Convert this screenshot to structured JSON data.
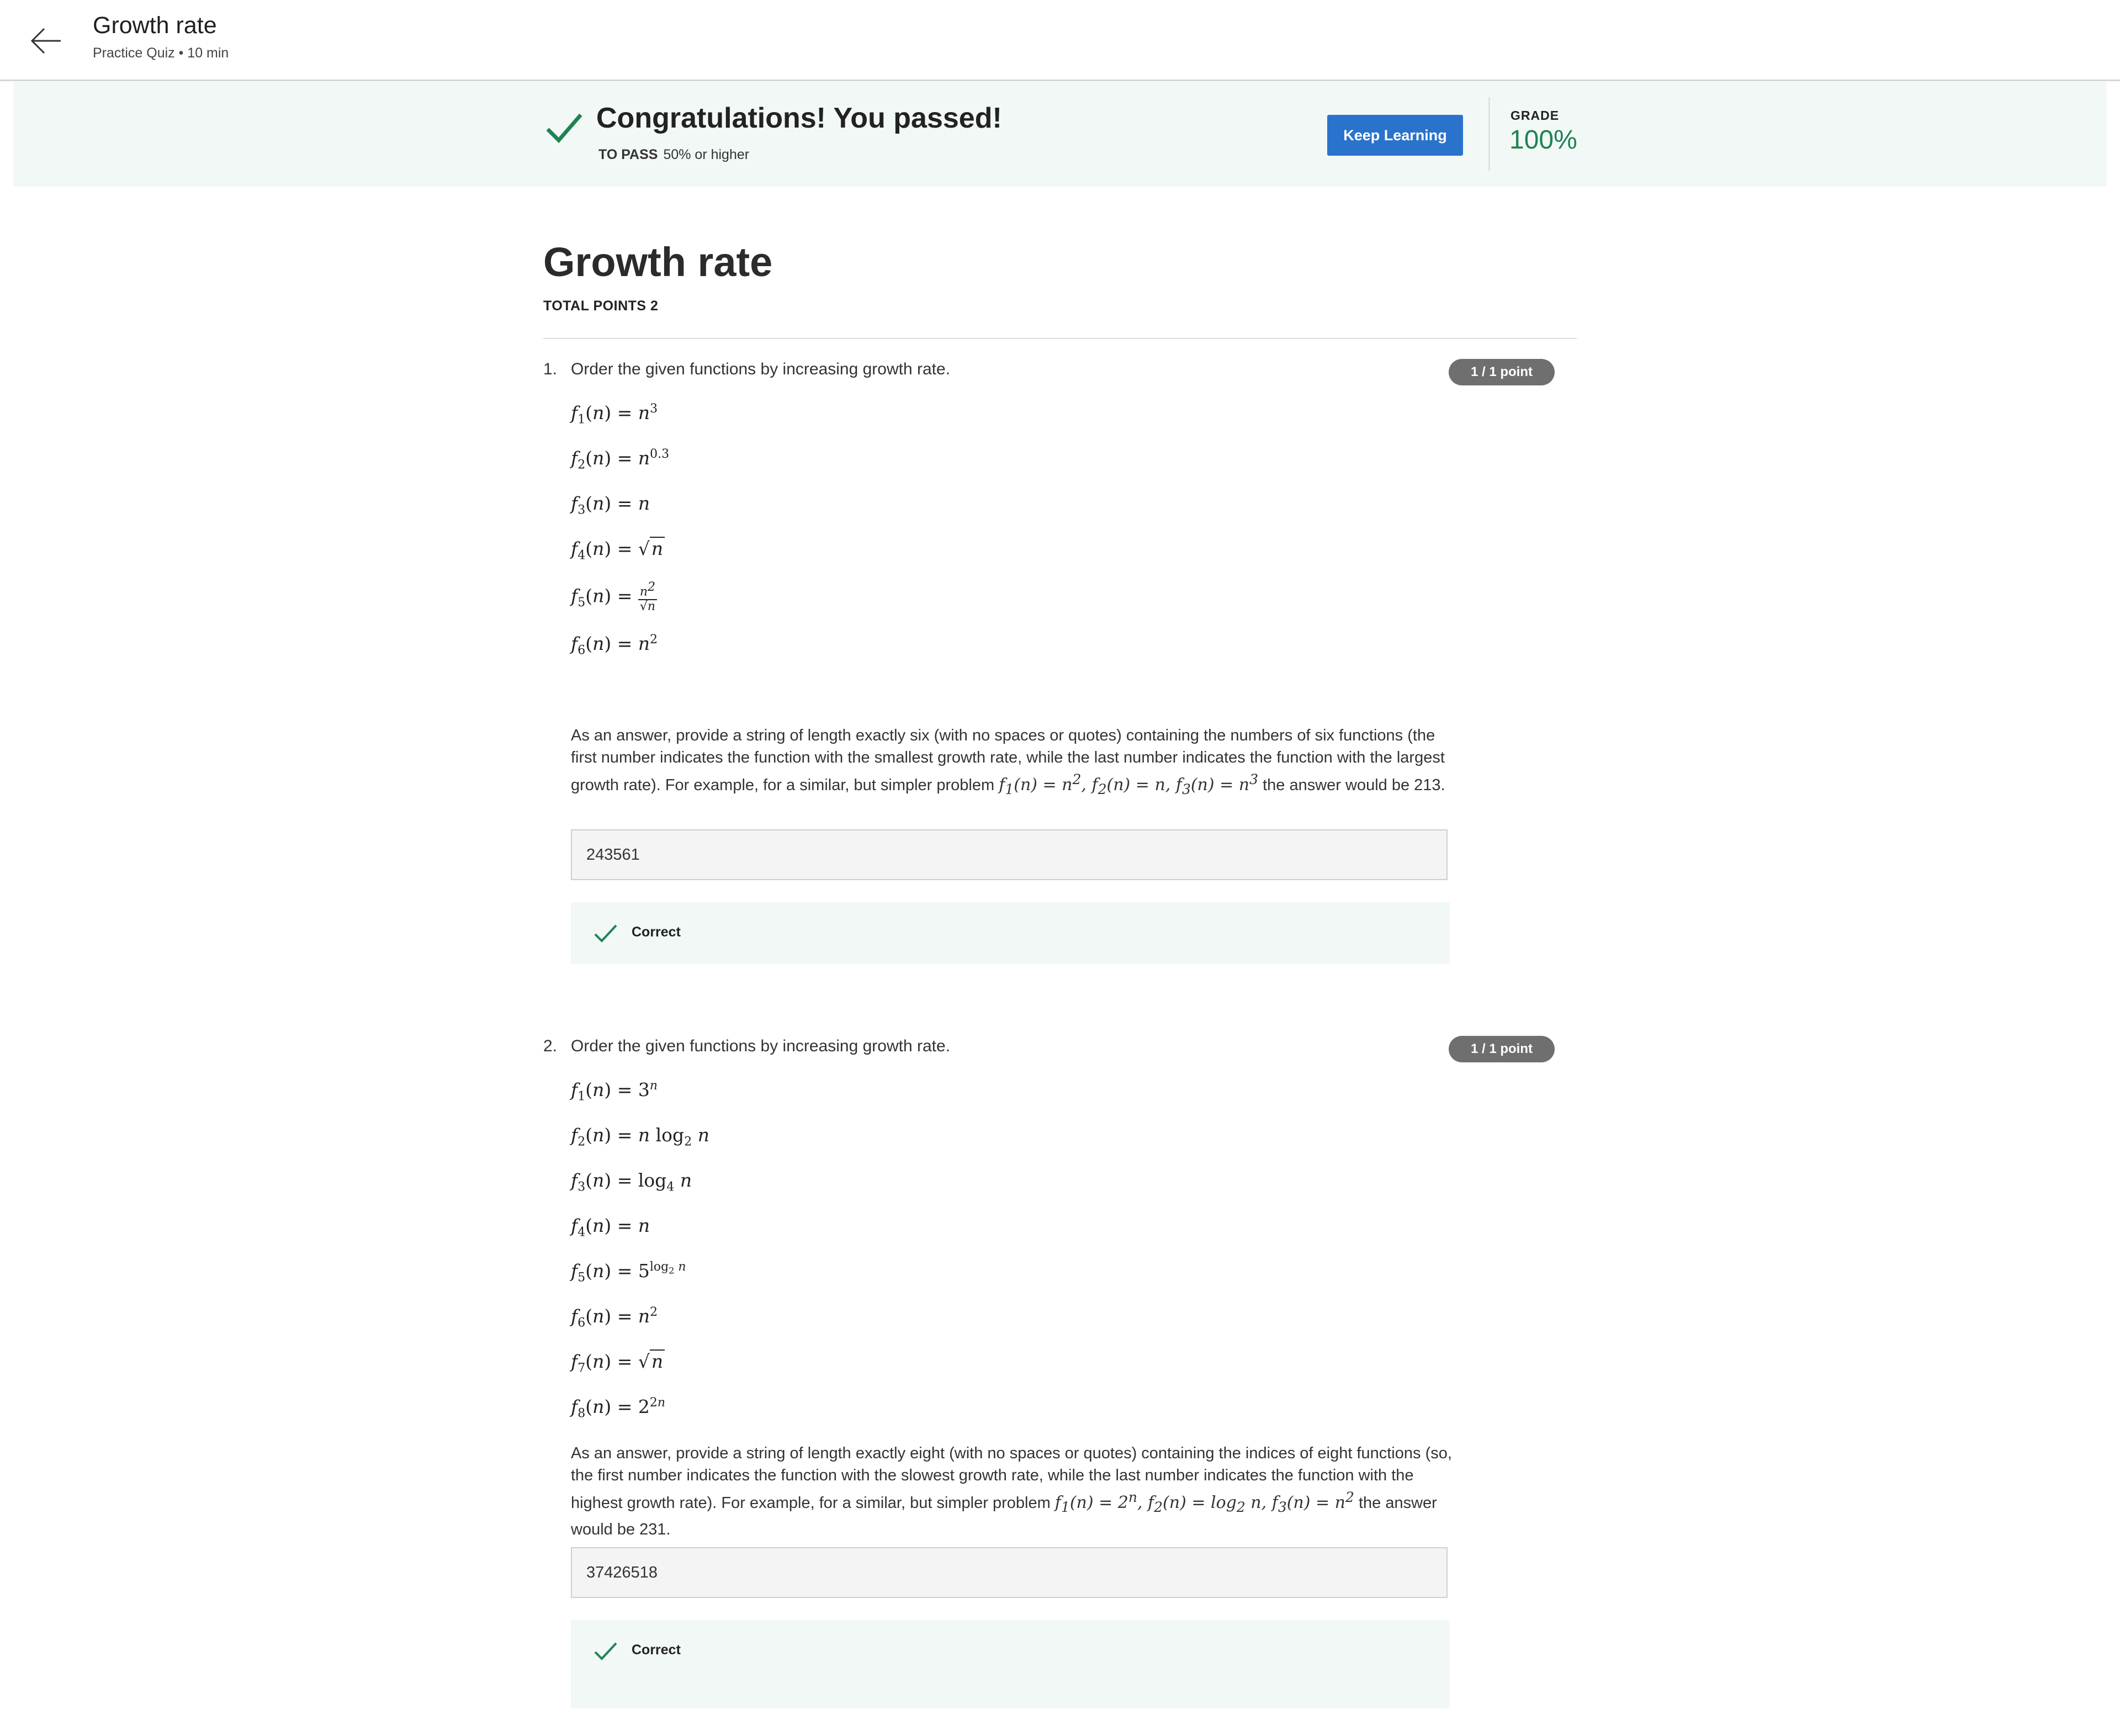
{
  "header": {
    "back_icon": "arrow-left-icon",
    "title": "Growth rate",
    "subtitle": "Practice Quiz • 10 min"
  },
  "banner": {
    "check_icon": "checkmark-icon",
    "title": "Congratulations! You passed!",
    "to_pass_label": "TO PASS",
    "to_pass_value": "50% or higher",
    "keep_learning": "Keep Learning",
    "grade_label": "GRADE",
    "grade_value": "100%",
    "accent_color": "#1f8354",
    "button_color": "#2a73cc"
  },
  "quiz": {
    "title": "Growth rate",
    "total_points": "TOTAL POINTS 2",
    "questions": [
      {
        "number": "1.",
        "prompt": "Order the given functions by increasing growth rate.",
        "points": "1 / 1 point",
        "formulas": [
          "f1(n) = n^3",
          "f2(n) = n^0.3",
          "f3(n) = n",
          "f4(n) = √n",
          "f5(n) = n^2/√n",
          "f6(n) = n^2"
        ],
        "instructions_a": "As an answer, provide a string of length exactly six (with no spaces or quotes) containing the numbers of six functions (the first number indicates the function with the smallest growth rate, while the last number indicates the function with the largest growth rate). For example, for a similar, but simpler problem",
        "instructions_b": "the answer would be 213.",
        "answer": "243561",
        "result": "Correct"
      },
      {
        "number": "2.",
        "prompt": "Order the given functions by increasing growth rate.",
        "points": "1 / 1 point",
        "formulas": [
          "f1(n) = 3^n",
          "f2(n) = n log2 n",
          "f3(n) = log4 n",
          "f4(n) = n",
          "f5(n) = 5^(log2 n)",
          "f6(n) = n^2",
          "f7(n) = √n",
          "f8(n) = 2^(2n)"
        ],
        "instructions_a": "As an answer, provide a string of length exactly eight (with no spaces or quotes) containing the indices of eight functions (so, the first number indicates the function with the slowest growth rate, while the last number indicates the function with the highest growth rate). For example, for a similar, but simpler problem",
        "instructions_b": "the answer would be 231.",
        "answer": "37426518",
        "result": "Correct"
      }
    ]
  }
}
